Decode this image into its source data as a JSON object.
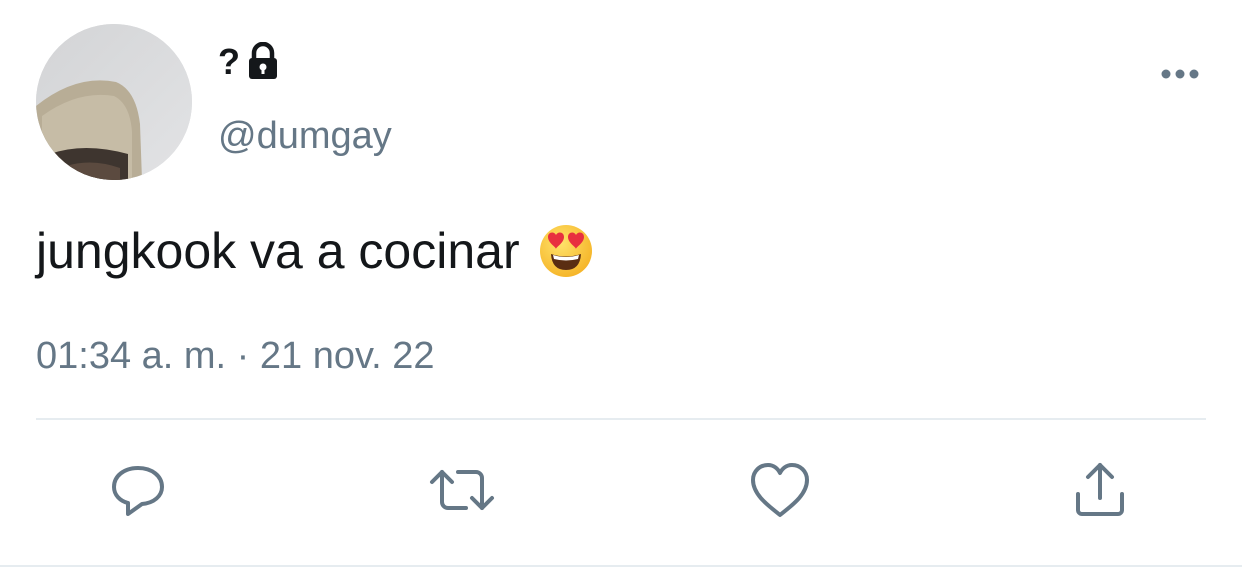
{
  "tweet": {
    "author": {
      "display_name": "?",
      "handle": "@dumgay",
      "protected_icon": "lock-icon",
      "avatar_icon": "avatar-photo"
    },
    "text": "jungkook va a cocinar",
    "emoji": "smiling-face-with-heart-eyes",
    "timestamp": "01:34 a. m. · 21 nov. 22",
    "more_icon": "more-horizontal-icon",
    "actions": [
      {
        "name": "reply",
        "icon": "reply-icon"
      },
      {
        "name": "retweet",
        "icon": "retweet-icon"
      },
      {
        "name": "like",
        "icon": "heart-icon"
      },
      {
        "name": "share",
        "icon": "share-icon"
      }
    ]
  },
  "colors": {
    "text_primary": "#14171a",
    "text_secondary": "#657786",
    "divider": "#e6ecf0",
    "icon": "#657786"
  }
}
